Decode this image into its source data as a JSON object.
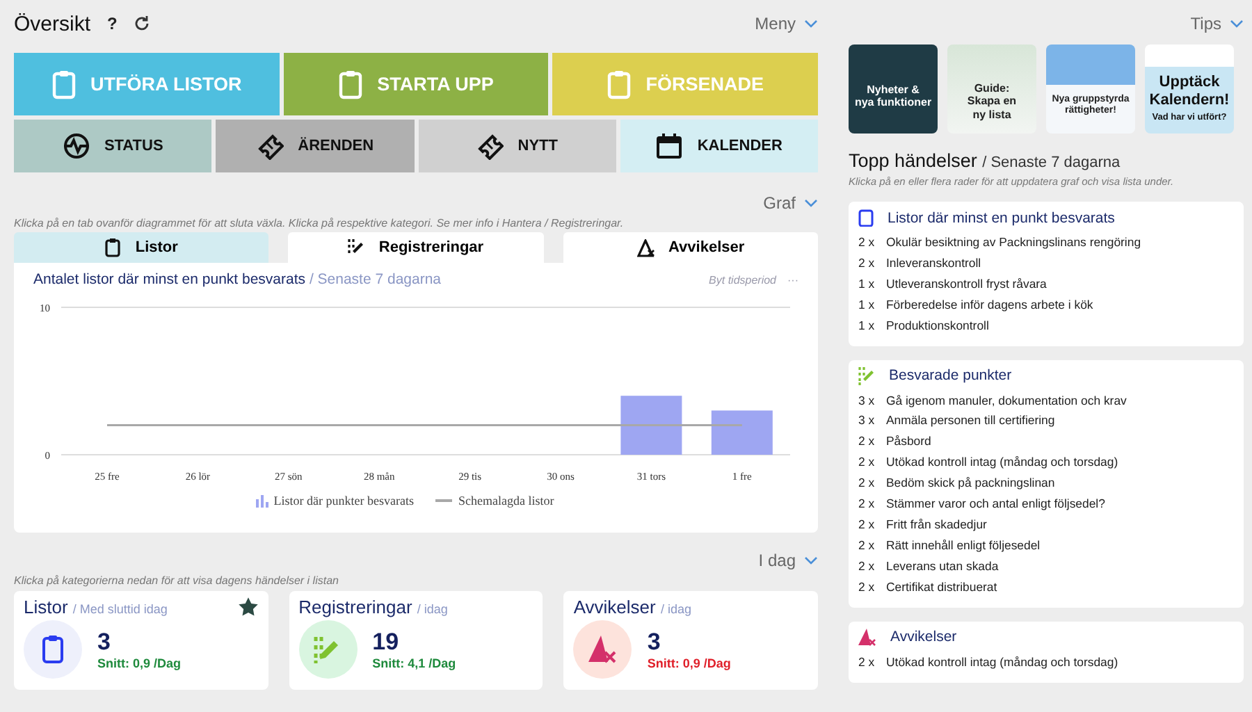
{
  "header": {
    "title": "Översikt",
    "help": "?",
    "menu": "Meny"
  },
  "main_buttons": [
    {
      "label": "UTFÖRA LISTOR",
      "color": "#4fbfdf"
    },
    {
      "label": "STARTA UPP",
      "color": "#8db145"
    },
    {
      "label": "FÖRSENADE",
      "color": "#dccf4f"
    }
  ],
  "nav_buttons": [
    {
      "label": "STATUS",
      "kind": "status",
      "color": "#adc9c5"
    },
    {
      "label": "ÄRENDEN",
      "kind": "ticket",
      "color": "#b0b0b0"
    },
    {
      "label": "NYTT",
      "kind": "ticket",
      "color": "#d0d0d0"
    },
    {
      "label": "KALENDER",
      "kind": "calendar",
      "color": "#d4eef3"
    }
  ],
  "graph_section": {
    "toggle": "Graf",
    "hint": "Klicka på en tab ovanför diagrammet för att sluta växla. Klicka på respektive kategori. Se mer info i Hantera / Registreringar.",
    "tabs": [
      {
        "label": "Listor",
        "kind": "lists",
        "selected": true
      },
      {
        "label": "Registreringar",
        "kind": "registrations",
        "selected": false
      },
      {
        "label": "Avvikelser",
        "kind": "deviations",
        "selected": false
      }
    ],
    "chart_title": "Antalet listor där minst en punkt besvarats",
    "chart_subtitle": "/ Senaste 7 dagarna",
    "period_link": "Byt tidsperiod",
    "more": "···",
    "chart_data": {
      "type": "bar",
      "categories": [
        "25 fre",
        "26 lör",
        "27 sön",
        "28 mån",
        "29 tis",
        "30 ons",
        "31 tors",
        "1 fre"
      ],
      "series": [
        {
          "name": "Listor där punkter besvarats",
          "type": "bar",
          "color": "#9ea6f2",
          "values": [
            0,
            0,
            0,
            0,
            0,
            0,
            4,
            3
          ]
        },
        {
          "name": "Schemalagda listor",
          "type": "line",
          "color": "#a8a8a8",
          "values": [
            2,
            2,
            2,
            2,
            2,
            2,
            2,
            2
          ]
        }
      ],
      "ylim": [
        0,
        10
      ],
      "yticks": [
        0,
        10
      ],
      "legend": "bottom"
    }
  },
  "today_section": {
    "toggle": "I dag",
    "hint": "Klicka på kategorierna nedan för att visa dagens händelser i listan",
    "cards": [
      {
        "title": "Listor",
        "subtitle": "/ Med sluttid idag",
        "kind": "lists",
        "count": "3",
        "average": "Snitt: 0,9 /Dag",
        "color": "#1e8a3c",
        "starred": true
      },
      {
        "title": "Registreringar",
        "subtitle": "/ idag",
        "kind": "registrations",
        "count": "19",
        "average": "Snitt: 4,1 /Dag",
        "color": "#1e8a3c",
        "starred": false
      },
      {
        "title": "Avvikelser",
        "subtitle": "/ idag",
        "kind": "deviations",
        "count": "3",
        "average": "Snitt: 0,9 /Dag",
        "color": "#e0202a",
        "starred": false
      }
    ]
  },
  "tips": {
    "toggle": "Tips",
    "tiles": [
      {
        "kind": "photo",
        "lines": [
          "Nyheter &",
          "nya funktioner"
        ]
      },
      {
        "kind": "guide",
        "lines": [
          "Guide:",
          "Skapa en",
          "ny lista"
        ]
      },
      {
        "kind": "dialog",
        "lines": [
          "Nya gruppstyrda",
          "rättigheter!"
        ]
      },
      {
        "kind": "calendar",
        "lines": [
          "Upptäck",
          "Kalendern!",
          "Vad har vi utfört?"
        ]
      }
    ]
  },
  "top_events": {
    "title": "Topp händelser",
    "subtitle": "/ Senaste 7 dagarna",
    "hint": "Klicka på en eller flera rader för att uppdatera graf och visa lista under.",
    "groups": [
      {
        "title": "Listor där minst en punkt besvarats",
        "kind": "lists",
        "rows": [
          {
            "count": "2 x",
            "text": "Okulär besiktning av Packningslinans rengöring"
          },
          {
            "count": "2 x",
            "text": "Inleveranskontroll"
          },
          {
            "count": "1 x",
            "text": "Utleveranskontroll fryst råvara"
          },
          {
            "count": "1 x",
            "text": "Förberedelse inför dagens arbete i kök"
          },
          {
            "count": "1 x",
            "text": "Produktionskontroll"
          }
        ]
      },
      {
        "title": "Besvarade punkter",
        "kind": "registrations",
        "rows": [
          {
            "count": "3 x",
            "text": "Gå igenom manuler, dokumentation och krav"
          },
          {
            "count": "3 x",
            "text": "Anmäla personen till certifiering"
          },
          {
            "count": "2 x",
            "text": "Påsbord"
          },
          {
            "count": "2 x",
            "text": "Utökad kontroll intag (måndag och torsdag)"
          },
          {
            "count": "2 x",
            "text": "Bedöm skick på packningslinan"
          },
          {
            "count": "2 x",
            "text": "Stämmer varor och antal enligt följsedel?"
          },
          {
            "count": "2 x",
            "text": "Fritt från skadedjur"
          },
          {
            "count": "2 x",
            "text": "Rätt innehåll enligt följesedel"
          },
          {
            "count": "2 x",
            "text": "Leverans utan skada"
          },
          {
            "count": "2 x",
            "text": "Certifikat distribuerat"
          }
        ]
      },
      {
        "title": "Avvikelser",
        "kind": "deviations",
        "rows": [
          {
            "count": "2 x",
            "text": "Utökad kontroll intag (måndag och torsdag)"
          }
        ]
      }
    ]
  }
}
